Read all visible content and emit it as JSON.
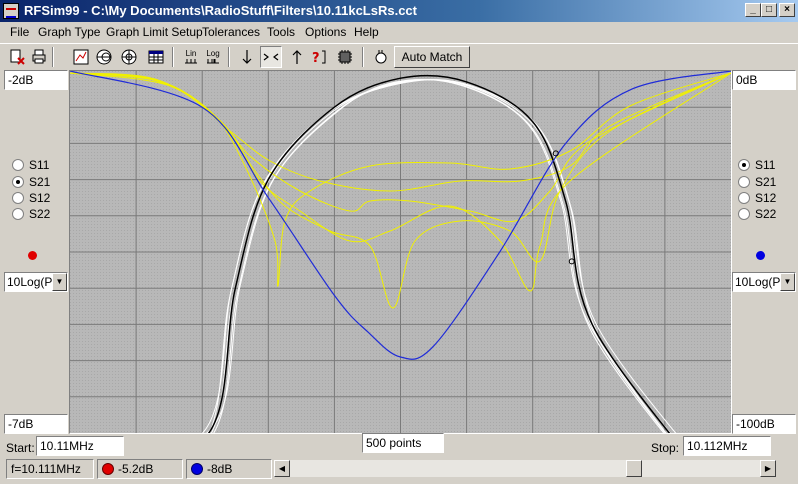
{
  "window": {
    "title": "RFSim99 - C:\\My Documents\\RadioStuff\\Filters\\10.11kcLsRs.cct"
  },
  "menu": [
    {
      "label": "File"
    },
    {
      "label": "Graph Type"
    },
    {
      "label": "Graph Limit Setup"
    },
    {
      "label": "Tolerances"
    },
    {
      "label": "Tools"
    },
    {
      "label": "Options"
    },
    {
      "label": "Help"
    }
  ],
  "toolbar": {
    "auto_match_label": "Auto Match",
    "lin_label": "Lin",
    "log_label": "Log",
    "icons": [
      "circuit-open-icon",
      "print-icon",
      "graph-icon",
      "smith-chart-icon",
      "polar-icon",
      "table-icon",
      "lin-scale-icon",
      "log-scale-icon",
      "arrow-down-icon",
      "zoom-in-icon",
      "arrow-up-icon",
      "help-cursor-icon",
      "component-icon",
      "hand-icon"
    ]
  },
  "left_axis": {
    "top": "-2dB",
    "bottom": "-7dB"
  },
  "right_axis": {
    "top": "0dB",
    "bottom": "-100dB"
  },
  "left_params": {
    "options": [
      "S11",
      "S21",
      "S12",
      "S22"
    ],
    "selected": "S21",
    "marker_color": "#e00000",
    "scale": "10Log(P)"
  },
  "right_params": {
    "options": [
      "S11",
      "S21",
      "S12",
      "S22"
    ],
    "selected": "S11",
    "marker_color": "#0000e0",
    "scale": "10Log(P)"
  },
  "sweep": {
    "start_label": "Start:",
    "start_value": "10.11MHz",
    "points": "500 points",
    "stop_label": "Stop:",
    "stop_value": "10.112MHz"
  },
  "status": {
    "freq": "f=10.111MHz",
    "left_reading": "-5.2dB",
    "right_reading": "-8dB"
  },
  "colors": {
    "plot_bg": "#b5b5b5",
    "grid": "#7a7a7a",
    "s21_nominal": "#000000",
    "s21_tolerance": "#ffffff",
    "s11_nominal": "#1f2bd8",
    "s11_tolerance": "#f0f000"
  },
  "chart_data": {
    "type": "line",
    "x_range": [
      "10.11MHz",
      "10.112MHz"
    ],
    "left_y_range": [
      -7,
      -2
    ],
    "right_y_range": [
      -100,
      0
    ],
    "series": [
      {
        "name": "S21",
        "axis": "left",
        "x": [
          10.1101,
          10.11042,
          10.1105,
          10.1106,
          10.1108,
          10.111,
          10.1112,
          10.1114,
          10.1115,
          10.11158,
          10.1119
        ],
        "values": [
          -7.5,
          -7.0,
          -5.0,
          -3.5,
          -2.5,
          -2.1,
          -2.15,
          -2.7,
          -3.8,
          -5.5,
          -7.5
        ]
      },
      {
        "name": "S11",
        "axis": "right",
        "x": [
          10.11,
          10.1104,
          10.1106,
          10.1108,
          10.1109,
          10.111,
          10.1111,
          10.1113,
          10.1115,
          10.1117,
          10.112
        ],
        "values": [
          0,
          -10,
          -35,
          -62,
          -72,
          -79,
          -76,
          -50,
          -20,
          -5,
          0
        ]
      }
    ]
  }
}
